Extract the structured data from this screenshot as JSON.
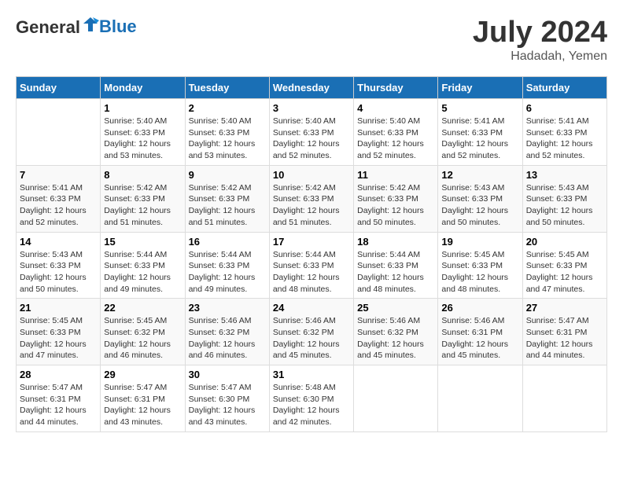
{
  "header": {
    "logo_general": "General",
    "logo_blue": "Blue",
    "month_year": "July 2024",
    "location": "Hadadah, Yemen"
  },
  "days_of_week": [
    "Sunday",
    "Monday",
    "Tuesday",
    "Wednesday",
    "Thursday",
    "Friday",
    "Saturday"
  ],
  "weeks": [
    [
      {
        "day": "",
        "sunrise": "",
        "sunset": "",
        "daylight": ""
      },
      {
        "day": "1",
        "sunrise": "Sunrise: 5:40 AM",
        "sunset": "Sunset: 6:33 PM",
        "daylight": "Daylight: 12 hours and 53 minutes."
      },
      {
        "day": "2",
        "sunrise": "Sunrise: 5:40 AM",
        "sunset": "Sunset: 6:33 PM",
        "daylight": "Daylight: 12 hours and 53 minutes."
      },
      {
        "day": "3",
        "sunrise": "Sunrise: 5:40 AM",
        "sunset": "Sunset: 6:33 PM",
        "daylight": "Daylight: 12 hours and 52 minutes."
      },
      {
        "day": "4",
        "sunrise": "Sunrise: 5:40 AM",
        "sunset": "Sunset: 6:33 PM",
        "daylight": "Daylight: 12 hours and 52 minutes."
      },
      {
        "day": "5",
        "sunrise": "Sunrise: 5:41 AM",
        "sunset": "Sunset: 6:33 PM",
        "daylight": "Daylight: 12 hours and 52 minutes."
      },
      {
        "day": "6",
        "sunrise": "Sunrise: 5:41 AM",
        "sunset": "Sunset: 6:33 PM",
        "daylight": "Daylight: 12 hours and 52 minutes."
      }
    ],
    [
      {
        "day": "7",
        "sunrise": "Sunrise: 5:41 AM",
        "sunset": "Sunset: 6:33 PM",
        "daylight": "Daylight: 12 hours and 52 minutes."
      },
      {
        "day": "8",
        "sunrise": "Sunrise: 5:42 AM",
        "sunset": "Sunset: 6:33 PM",
        "daylight": "Daylight: 12 hours and 51 minutes."
      },
      {
        "day": "9",
        "sunrise": "Sunrise: 5:42 AM",
        "sunset": "Sunset: 6:33 PM",
        "daylight": "Daylight: 12 hours and 51 minutes."
      },
      {
        "day": "10",
        "sunrise": "Sunrise: 5:42 AM",
        "sunset": "Sunset: 6:33 PM",
        "daylight": "Daylight: 12 hours and 51 minutes."
      },
      {
        "day": "11",
        "sunrise": "Sunrise: 5:42 AM",
        "sunset": "Sunset: 6:33 PM",
        "daylight": "Daylight: 12 hours and 50 minutes."
      },
      {
        "day": "12",
        "sunrise": "Sunrise: 5:43 AM",
        "sunset": "Sunset: 6:33 PM",
        "daylight": "Daylight: 12 hours and 50 minutes."
      },
      {
        "day": "13",
        "sunrise": "Sunrise: 5:43 AM",
        "sunset": "Sunset: 6:33 PM",
        "daylight": "Daylight: 12 hours and 50 minutes."
      }
    ],
    [
      {
        "day": "14",
        "sunrise": "Sunrise: 5:43 AM",
        "sunset": "Sunset: 6:33 PM",
        "daylight": "Daylight: 12 hours and 50 minutes."
      },
      {
        "day": "15",
        "sunrise": "Sunrise: 5:44 AM",
        "sunset": "Sunset: 6:33 PM",
        "daylight": "Daylight: 12 hours and 49 minutes."
      },
      {
        "day": "16",
        "sunrise": "Sunrise: 5:44 AM",
        "sunset": "Sunset: 6:33 PM",
        "daylight": "Daylight: 12 hours and 49 minutes."
      },
      {
        "day": "17",
        "sunrise": "Sunrise: 5:44 AM",
        "sunset": "Sunset: 6:33 PM",
        "daylight": "Daylight: 12 hours and 48 minutes."
      },
      {
        "day": "18",
        "sunrise": "Sunrise: 5:44 AM",
        "sunset": "Sunset: 6:33 PM",
        "daylight": "Daylight: 12 hours and 48 minutes."
      },
      {
        "day": "19",
        "sunrise": "Sunrise: 5:45 AM",
        "sunset": "Sunset: 6:33 PM",
        "daylight": "Daylight: 12 hours and 48 minutes."
      },
      {
        "day": "20",
        "sunrise": "Sunrise: 5:45 AM",
        "sunset": "Sunset: 6:33 PM",
        "daylight": "Daylight: 12 hours and 47 minutes."
      }
    ],
    [
      {
        "day": "21",
        "sunrise": "Sunrise: 5:45 AM",
        "sunset": "Sunset: 6:33 PM",
        "daylight": "Daylight: 12 hours and 47 minutes."
      },
      {
        "day": "22",
        "sunrise": "Sunrise: 5:45 AM",
        "sunset": "Sunset: 6:32 PM",
        "daylight": "Daylight: 12 hours and 46 minutes."
      },
      {
        "day": "23",
        "sunrise": "Sunrise: 5:46 AM",
        "sunset": "Sunset: 6:32 PM",
        "daylight": "Daylight: 12 hours and 46 minutes."
      },
      {
        "day": "24",
        "sunrise": "Sunrise: 5:46 AM",
        "sunset": "Sunset: 6:32 PM",
        "daylight": "Daylight: 12 hours and 45 minutes."
      },
      {
        "day": "25",
        "sunrise": "Sunrise: 5:46 AM",
        "sunset": "Sunset: 6:32 PM",
        "daylight": "Daylight: 12 hours and 45 minutes."
      },
      {
        "day": "26",
        "sunrise": "Sunrise: 5:46 AM",
        "sunset": "Sunset: 6:31 PM",
        "daylight": "Daylight: 12 hours and 45 minutes."
      },
      {
        "day": "27",
        "sunrise": "Sunrise: 5:47 AM",
        "sunset": "Sunset: 6:31 PM",
        "daylight": "Daylight: 12 hours and 44 minutes."
      }
    ],
    [
      {
        "day": "28",
        "sunrise": "Sunrise: 5:47 AM",
        "sunset": "Sunset: 6:31 PM",
        "daylight": "Daylight: 12 hours and 44 minutes."
      },
      {
        "day": "29",
        "sunrise": "Sunrise: 5:47 AM",
        "sunset": "Sunset: 6:31 PM",
        "daylight": "Daylight: 12 hours and 43 minutes."
      },
      {
        "day": "30",
        "sunrise": "Sunrise: 5:47 AM",
        "sunset": "Sunset: 6:30 PM",
        "daylight": "Daylight: 12 hours and 43 minutes."
      },
      {
        "day": "31",
        "sunrise": "Sunrise: 5:48 AM",
        "sunset": "Sunset: 6:30 PM",
        "daylight": "Daylight: 12 hours and 42 minutes."
      },
      {
        "day": "",
        "sunrise": "",
        "sunset": "",
        "daylight": ""
      },
      {
        "day": "",
        "sunrise": "",
        "sunset": "",
        "daylight": ""
      },
      {
        "day": "",
        "sunrise": "",
        "sunset": "",
        "daylight": ""
      }
    ]
  ]
}
